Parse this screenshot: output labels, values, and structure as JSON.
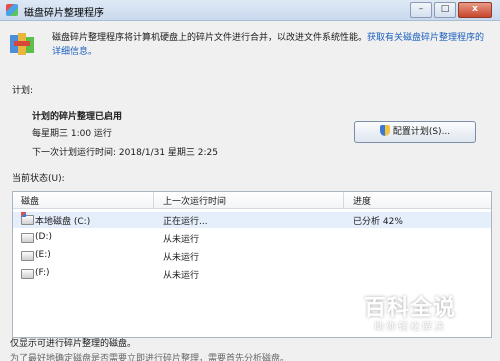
{
  "window": {
    "title": "磁盘碎片整理程序",
    "controls": {
      "minimize": "–",
      "maximize": "□",
      "close": "x"
    }
  },
  "header": {
    "description": "磁盘碎片整理程序将计算机硬盘上的碎片文件进行合并，以改进文件系统性能。",
    "link": "获取有关磁盘碎片整理程序的详细信息。"
  },
  "schedule": {
    "section_label": "计划:",
    "status": "计划的碎片整理已启用",
    "run_time": "每星期三  1:00 运行",
    "next_run": "下一次计划运行时间: 2018/1/31 星期三 2:25",
    "configure_button": "配置计划(S)..."
  },
  "current_status": {
    "section_label": "当前状态(U):",
    "columns": [
      "磁盘",
      "上一次运行时间",
      "进度"
    ],
    "rows": [
      {
        "disk": "本地磁盘 (C:)",
        "last_run": "正在运行...",
        "progress": "已分析 42%"
      },
      {
        "disk": "(D:)",
        "last_run": "从未运行",
        "progress": ""
      },
      {
        "disk": "(E:)",
        "last_run": "从未运行",
        "progress": ""
      },
      {
        "disk": "(F:)",
        "last_run": "从未运行",
        "progress": ""
      }
    ]
  },
  "footer": {
    "note": "仅显示可进行碎片整理的磁盘。",
    "note2": "为了最好地确定磁盘是否需要立即进行碎片整理，需要首先分析磁盘。"
  },
  "watermark": {
    "logo": "百科全说",
    "tagline": "助你轻松解决"
  }
}
